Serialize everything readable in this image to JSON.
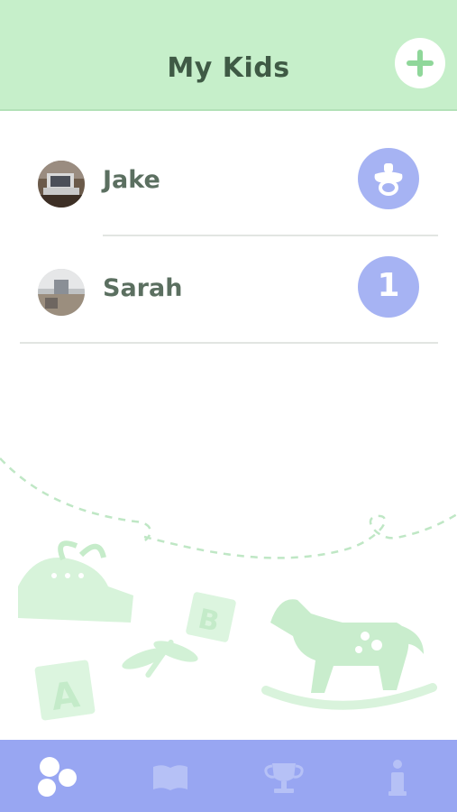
{
  "header": {
    "title": "My Kids",
    "add_icon": "plus-icon"
  },
  "kids": [
    {
      "name": "Jake",
      "status_icon": "pacifier-icon",
      "status_text": ""
    },
    {
      "name": "Sarah",
      "status_icon": "number-badge",
      "status_text": "1"
    }
  ],
  "tabbar": {
    "tabs": [
      {
        "icon": "kids-circles-icon",
        "active": true
      },
      {
        "icon": "book-icon",
        "active": false
      },
      {
        "icon": "trophy-icon",
        "active": false
      },
      {
        "icon": "info-icon",
        "active": false
      }
    ]
  },
  "background": {
    "decor": [
      "baby-shoe-illustration",
      "block-a-illustration",
      "block-b-illustration",
      "dragonfly-illustration",
      "rocking-horse-illustration"
    ]
  },
  "colors": {
    "header_bg": "#c6efca",
    "title_text": "#3f5a45",
    "status_circle": "#a6b3f3",
    "tabbar_bg": "#98a6f2",
    "decor_green": "#d7f3da"
  }
}
